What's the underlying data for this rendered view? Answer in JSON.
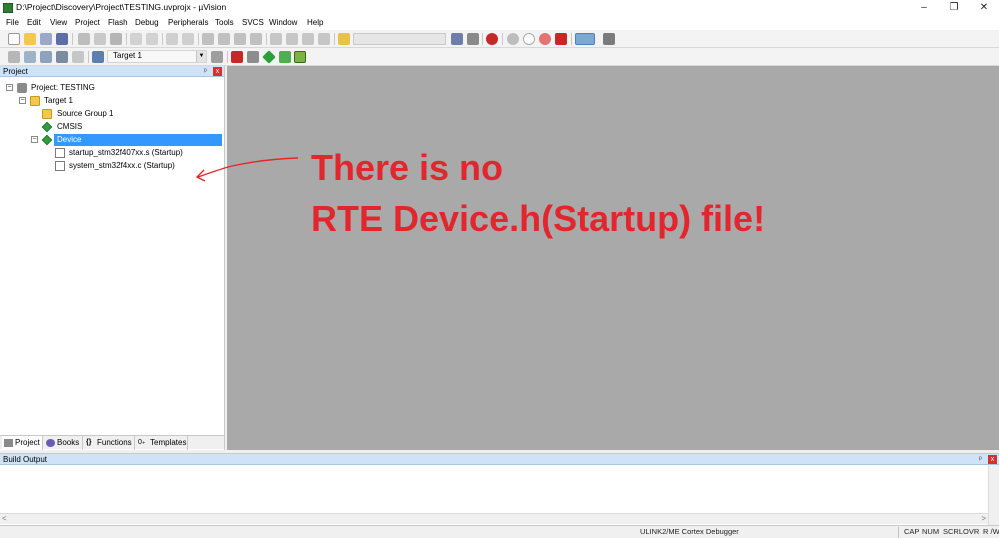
{
  "window": {
    "title": "D:\\Project\\Discovery\\Project\\TESTING.uvprojx - µVision",
    "minimize_glyph": "–",
    "maximize_glyph": "❐",
    "close_glyph": "✕"
  },
  "menu": [
    "File",
    "Edit",
    "View",
    "Project",
    "Flash",
    "Debug",
    "Peripherals",
    "Tools",
    "SVCS",
    "Window",
    "Help"
  ],
  "toolbar": {
    "target_label": "Target 1",
    "dropdown_arrow": "▼"
  },
  "project_panel": {
    "title": "Project",
    "pin_glyph": "ᵖ",
    "close_glyph": "x",
    "tree": [
      {
        "label": "Project: TESTING",
        "expander": "−"
      },
      {
        "label": "Target 1",
        "expander": "−"
      },
      {
        "label": "Source Group 1"
      },
      {
        "label": "CMSIS"
      },
      {
        "label": "Device",
        "expander": "−",
        "selected": true
      },
      {
        "label": "startup_stm32f407xx.s (Startup)"
      },
      {
        "label": "system_stm32f4xx.c (Startup)"
      }
    ],
    "tabs": [
      "Project",
      "Books",
      "Functions",
      "Templates"
    ],
    "tab_icons": [
      "",
      "",
      "{}",
      "0₊"
    ]
  },
  "annotation": {
    "line1": "There is no",
    "line2": "RTE  Device.h(Startup) file!",
    "color": "#e3262d"
  },
  "build_output": {
    "title": "Build Output",
    "pin_glyph": "ᵖ",
    "close_glyph": "x",
    "left_arrow": "<",
    "right_arrow": ">"
  },
  "status_bar": {
    "debugger": "ULINK2/ME Cortex Debugger",
    "cap": "CAP",
    "num": "NUM",
    "scrl": "SCRL",
    "ovr": "OVR",
    "rw": "R /W"
  }
}
